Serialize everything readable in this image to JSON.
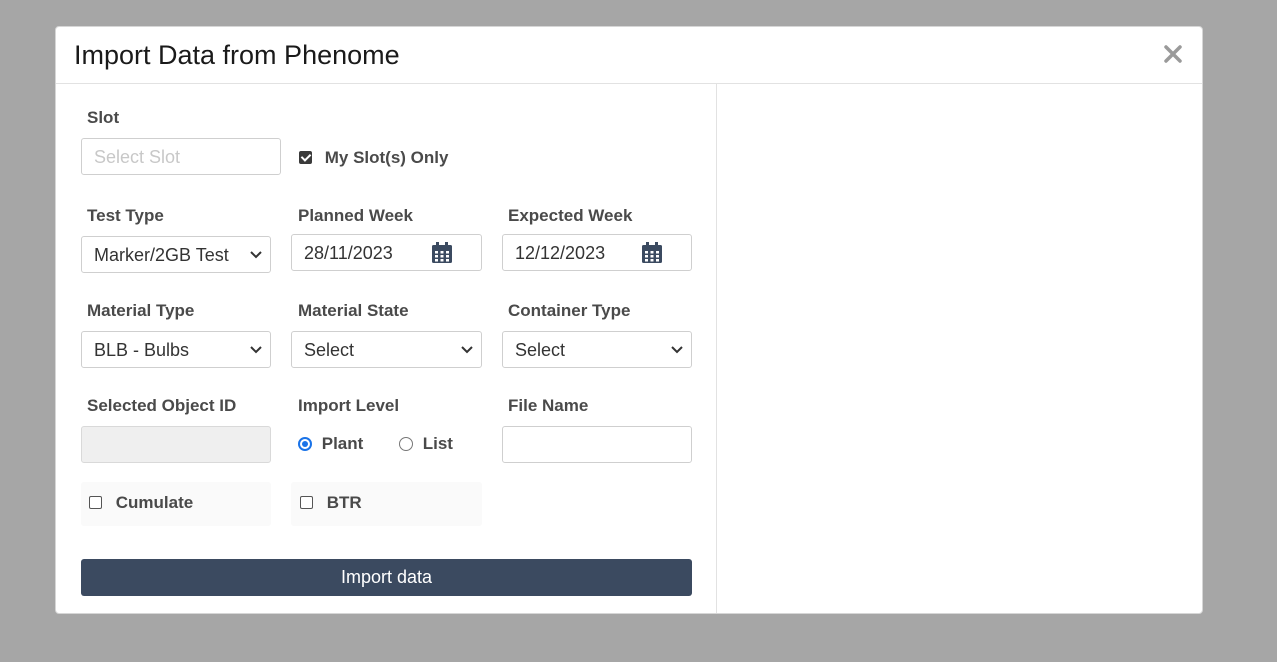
{
  "modal": {
    "title": "Import Data from Phenome"
  },
  "form": {
    "slot": {
      "label": "Slot",
      "placeholder": "Select Slot"
    },
    "my_slots_only": {
      "label": "My Slot(s) Only",
      "checked": true
    },
    "test_type": {
      "label": "Test Type",
      "value": "Marker/2GB Test"
    },
    "planned_week": {
      "label": "Planned Week",
      "value": "28/11/2023"
    },
    "expected_week": {
      "label": "Expected Week",
      "value": "12/12/2023"
    },
    "material_type": {
      "label": "Material Type",
      "value": "BLB - Bulbs"
    },
    "material_state": {
      "label": "Material State",
      "value": "Select"
    },
    "container_type": {
      "label": "Container Type",
      "value": "Select"
    },
    "selected_object_id": {
      "label": "Selected Object ID",
      "value": ""
    },
    "import_level": {
      "label": "Import Level",
      "options": [
        "Plant",
        "List"
      ],
      "selected": "Plant"
    },
    "file_name": {
      "label": "File Name",
      "value": ""
    },
    "cumulate": {
      "label": "Cumulate",
      "checked": false
    },
    "btr": {
      "label": "BTR",
      "checked": false
    },
    "import_button": "Import data"
  },
  "colors": {
    "backdrop": "#a6a6a6",
    "button": "#3b4a60",
    "radio_accent": "#1a73e8"
  },
  "icons": [
    "close-icon",
    "chevron-down-icon",
    "calendar-icon",
    "checkbox-icon",
    "radio-icon"
  ]
}
